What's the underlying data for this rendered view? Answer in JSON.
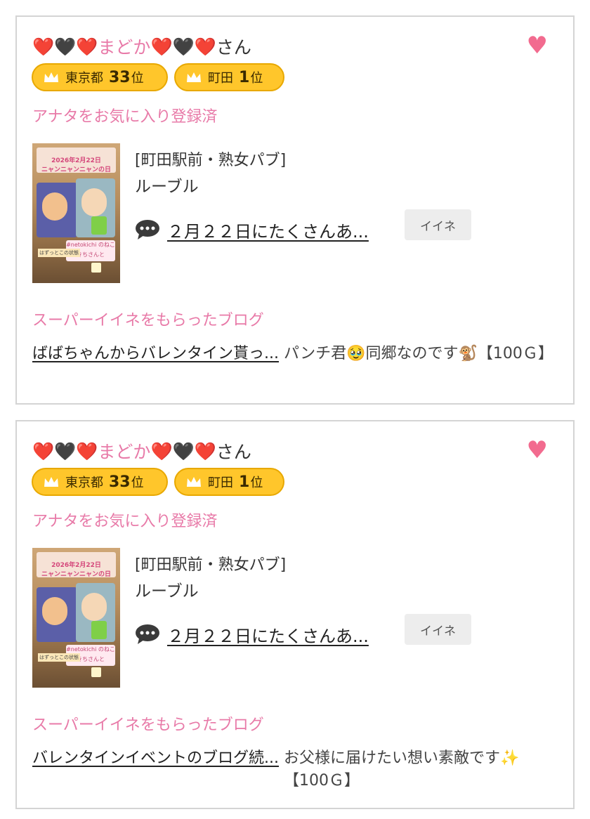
{
  "cards": [
    {
      "name_prefix_hearts": [
        "❤️",
        "🖤",
        "❤️"
      ],
      "name": "まどか",
      "name_suffix_hearts": [
        "❤️",
        "🖤",
        "❤️"
      ],
      "honorific": "さん",
      "badges": [
        {
          "area": "東京都",
          "rank": "33",
          "unit": "位"
        },
        {
          "area": "町田",
          "rank": "1",
          "unit": "位"
        }
      ],
      "fav_status": "アナタをお気に入り登録済",
      "thumbnail": {
        "date": "2026年2月22日",
        "headline": "ニャンニャンニャンの日",
        "caption": "#netokichi\nのねこきちさんと",
        "footer": "はずっとこの状態"
      },
      "shop_area": "[町田駅前・熟女パブ]",
      "shop_name": "ルーブル",
      "blog_title": "２月２２日にたくさんあ...",
      "iine_label": "イイネ",
      "super_title": "スーパーイイネをもらったブログ",
      "super_blog": "ばばちゃんからバレンタイン貰っ...",
      "super_comment": "パンチ君🥹同郷なのです🐒【100Ｇ】"
    },
    {
      "name_prefix_hearts": [
        "❤️",
        "🖤",
        "❤️"
      ],
      "name": "まどか",
      "name_suffix_hearts": [
        "❤️",
        "🖤",
        "❤️"
      ],
      "honorific": "さん",
      "badges": [
        {
          "area": "東京都",
          "rank": "33",
          "unit": "位"
        },
        {
          "area": "町田",
          "rank": "1",
          "unit": "位"
        }
      ],
      "fav_status": "アナタをお気に入り登録済",
      "thumbnail": {
        "date": "2026年2月22日",
        "headline": "ニャンニャンニャンの日",
        "caption": "#netokichi\nのねこきちさんと",
        "footer": "はずっとこの状態"
      },
      "shop_area": "[町田駅前・熟女パブ]",
      "shop_name": "ルーブル",
      "blog_title": "２月２２日にたくさんあ...",
      "iine_label": "イイネ",
      "super_title": "スーパーイイネをもらったブログ",
      "super_blog": "バレンタインイベントのブログ続...",
      "super_comment": "お父様に届けたい想い素敵です✨【100Ｇ】"
    }
  ],
  "colors": {
    "pink": "#e87aa8",
    "badge": "#ffc62b",
    "heart": "#f26b8f"
  },
  "icons": {
    "favorite": "heart-icon",
    "crown": "crown-icon",
    "comment": "speech-bubble-icon"
  }
}
